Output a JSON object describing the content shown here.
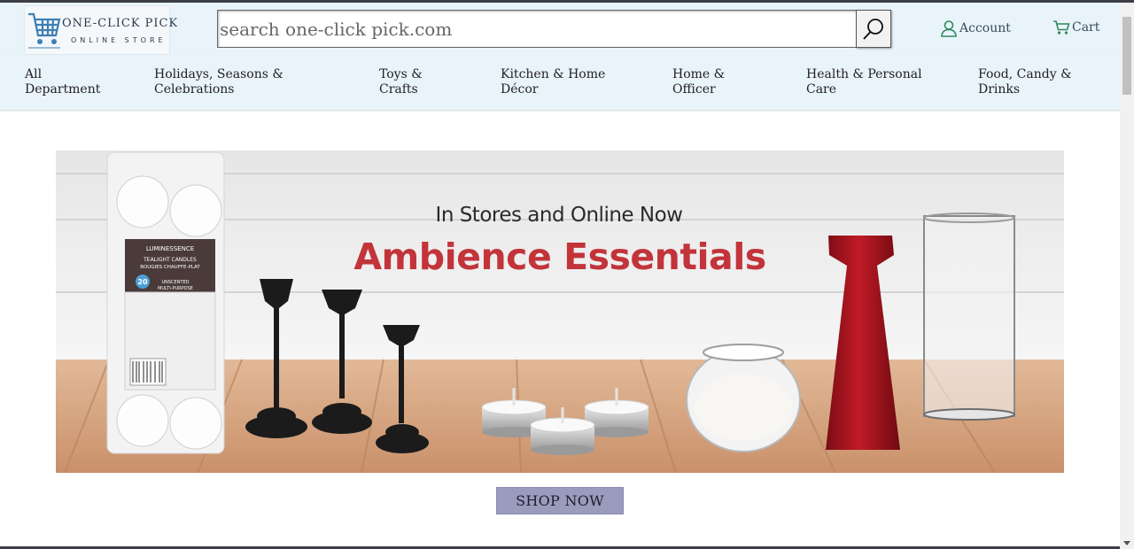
{
  "header": {
    "brand_name": "ONE-CLICK PICK",
    "brand_tagline": "ONLINE STORE",
    "search_placeholder": "search one-click pick.com",
    "account_label": "Account",
    "cart_label": "Cart"
  },
  "nav": {
    "items": [
      {
        "line1": "All",
        "line2": "Department"
      },
      {
        "line1": "Holidays, Seasons &",
        "line2": "Celebrations"
      },
      {
        "line1": "Toys &",
        "line2": "Crafts"
      },
      {
        "line1": "Kitchen & Home",
        "line2": "Décor"
      },
      {
        "line1": "Home &",
        "line2": "Officer"
      },
      {
        "line1": "Health & Personal",
        "line2": "Care"
      },
      {
        "line1": "Food, Candy &",
        "line2": "Drinks"
      }
    ]
  },
  "banner": {
    "headline_small": "In Stores and Online Now",
    "headline_large": "Ambience Essentials",
    "package_brand": "LUMINESSENCE",
    "package_title": "TEALIGHT CANDLES",
    "package_subtitle": "BOUGIES CHAUFFE-PLAT",
    "package_count": "20",
    "package_note1": "UNSCENTED",
    "package_note2": "MULTI-PURPOSE"
  },
  "cta": {
    "shop_now_label": "SHOP NOW"
  },
  "colors": {
    "header_bg": "#e9f3fa",
    "accent_green": "#2c6b4e",
    "headline_red": "#c2343a",
    "cta_bg": "#9b9bbd"
  }
}
